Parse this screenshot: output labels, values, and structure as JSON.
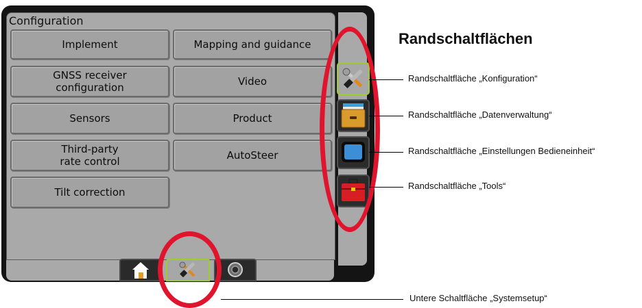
{
  "panel": {
    "title": "Configuration"
  },
  "config_buttons": [
    "Implement",
    "Mapping and guidance",
    "GNSS receiver\nconfiguration",
    "Video",
    "Sensors",
    "Product",
    "Third-party\nrate control",
    "AutoSteer",
    "Tilt correction"
  ],
  "side_buttons": [
    {
      "name": "configuration",
      "icon": "tools-icon",
      "active": true
    },
    {
      "name": "data-management",
      "icon": "file-drawer-icon",
      "active": false
    },
    {
      "name": "console-settings",
      "icon": "display-icon",
      "active": false
    },
    {
      "name": "tools",
      "icon": "toolbox-icon",
      "active": false
    }
  ],
  "bottom_tabs": [
    {
      "name": "home",
      "icon": "home-icon",
      "active": false
    },
    {
      "name": "system-setup",
      "icon": "tools-icon",
      "active": true
    },
    {
      "name": "camera",
      "icon": "camera-icon",
      "active": false
    }
  ],
  "annotations": {
    "heading": "Randschaltflächen",
    "configuration": "Randschaltfläche „Konfiguration“",
    "data_management": "Randschaltfläche „Datenverwaltung“",
    "console_settings": "Randschaltfläche „Einstellungen Bedieneinheit“",
    "tools": "Randschaltfläche „Tools“",
    "system_setup": "Untere Schaltfläche „Systemsetup“"
  },
  "colors": {
    "highlight": "#e1142e",
    "active_border": "#9ccc2e",
    "panel": "#a9a9a9",
    "bezel": "#141414"
  }
}
